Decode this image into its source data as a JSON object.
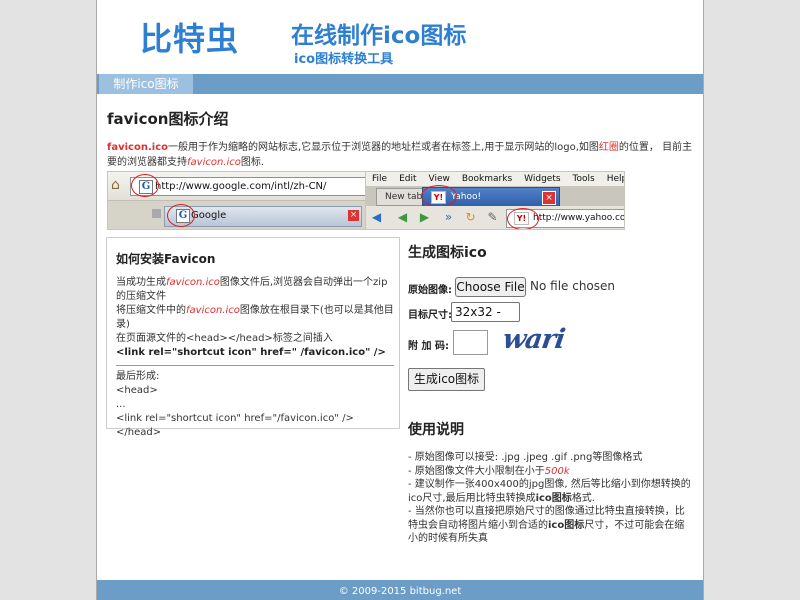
{
  "header": {
    "logo": "比特虫",
    "title": "在线制作ico图标",
    "subtitle": "ico图标转换工具"
  },
  "nav": {
    "tab_make_ico": "制作ico图标"
  },
  "intro": {
    "title": "favicon图标介绍",
    "p_start": "favicon.ico",
    "p_mid": "一般用于作为缩略的网站标志,它显示位于浏览器的地址栏或者在标签上,用于显示网站的logo,如图",
    "p_red": "红圈",
    "p_after": "的位置， 目前主要的浏览器都支持",
    "p_fav": "favicon.ico",
    "p_end": "图标."
  },
  "shot_ie": {
    "url": "http://www.google.com/intl/zh-CN/",
    "tab_title": "Google",
    "icon_letter": "G"
  },
  "shot_ff": {
    "menu": [
      "File",
      "Edit",
      "View",
      "Bookmarks",
      "Widgets",
      "Tools",
      "Help"
    ],
    "tab_new": "New tab",
    "tab_active": "Yahoo!",
    "url": "http://www.yahoo.com",
    "icon_letter": "Y!"
  },
  "install": {
    "title": "如何安装Favicon",
    "l1a": "当成功生成",
    "l1b": "favicon.ico",
    "l1c": "图像文件后,浏览器会自动弹出一个zip的压缩文件",
    "l2a": "将压缩文件中的",
    "l2b": "favicon.ico",
    "l2c": "图像放在根目录下(也可以是其他目录)",
    "l3": "在页面源文件的<head></head>标签之间插入",
    "l4": "<link rel=\"shortcut icon\" href=\" /favicon.ico\" />",
    "l5": "最后形成:",
    "l6": "<head>",
    "l7": "...",
    "l8": "<link rel=\"shortcut icon\" href=\"/favicon.ico\" />",
    "l9": "</head>"
  },
  "generator": {
    "title": "生成图标ico",
    "label_source": "原始图像:",
    "file_button": "Choose File",
    "file_status": "No file chosen",
    "label_size": "目标尺寸:",
    "size_value": "32x32 -",
    "label_captcha": "附 加 码:",
    "captcha_text": "wari",
    "submit": "生成ico图标"
  },
  "usage": {
    "title": "使用说明",
    "u1": "- 原始图像可以接受: .jpg .jpeg .gif .png等图像格式",
    "u2a": "- 原始图像文件大小限制在小于",
    "u2b": "500k",
    "u3a": "- 建议制作一张400x400的jpg图像, 然后等比缩小到你想转换的ico尺寸,最后用比特虫转换成",
    "u3b": "ico图标",
    "u3c": "格式.",
    "u4a": "- 当然你也可以直接把原始尺寸的图像通过比特虫直接转换，比特虫会自动将图片缩小到合适的",
    "u4b": "ico图标",
    "u4c": "尺寸，不过可能会在缩小的时候有所失真"
  },
  "footer": {
    "text": "© 2009-2015 bitbug.net"
  }
}
